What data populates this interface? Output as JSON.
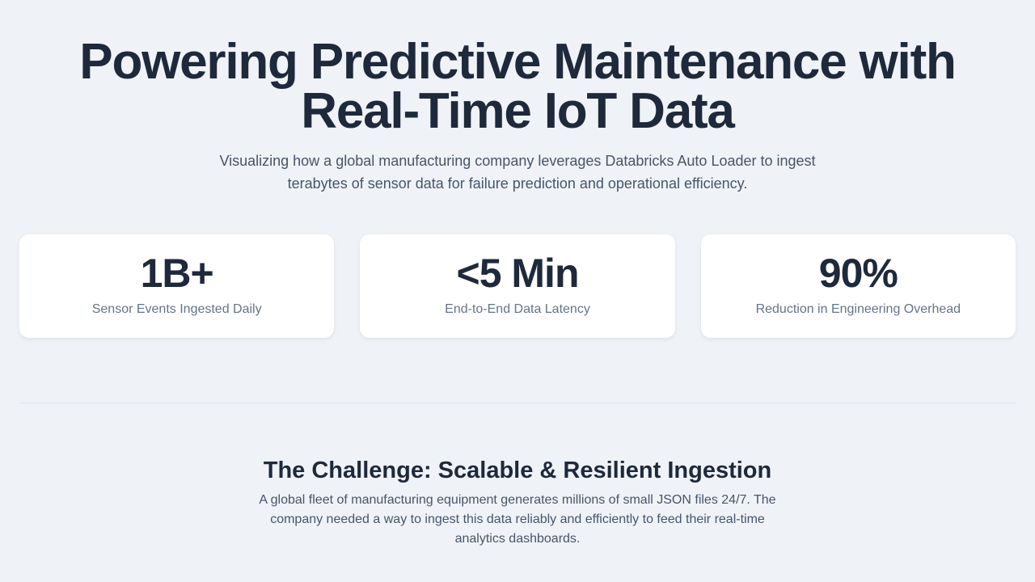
{
  "hero": {
    "title_line1": "Powering Predictive Maintenance with",
    "title_line2": "Real-Time IoT Data",
    "subtitle": "Visualizing how a global manufacturing company leverages Databricks Auto Loader to ingest terabytes of sensor data for failure prediction and operational efficiency."
  },
  "stats": [
    {
      "value": "1B+",
      "label": "Sensor Events Ingested Daily"
    },
    {
      "value": "<5 Min",
      "label": "End-to-End Data Latency"
    },
    {
      "value": "90%",
      "label": "Reduction in Engineering Overhead"
    }
  ],
  "challenge": {
    "title": "The Challenge: Scalable & Resilient Ingestion",
    "text": "A global fleet of manufacturing equipment generates millions of small JSON files 24/7. The company needed a way to ingest this data reliably and efficiently to feed their real-time analytics dashboards."
  },
  "colors": {
    "background": "#eff2f7",
    "heading": "#1e293b",
    "body_text": "#475569",
    "muted_text": "#64748b",
    "card": "#ffffff"
  }
}
